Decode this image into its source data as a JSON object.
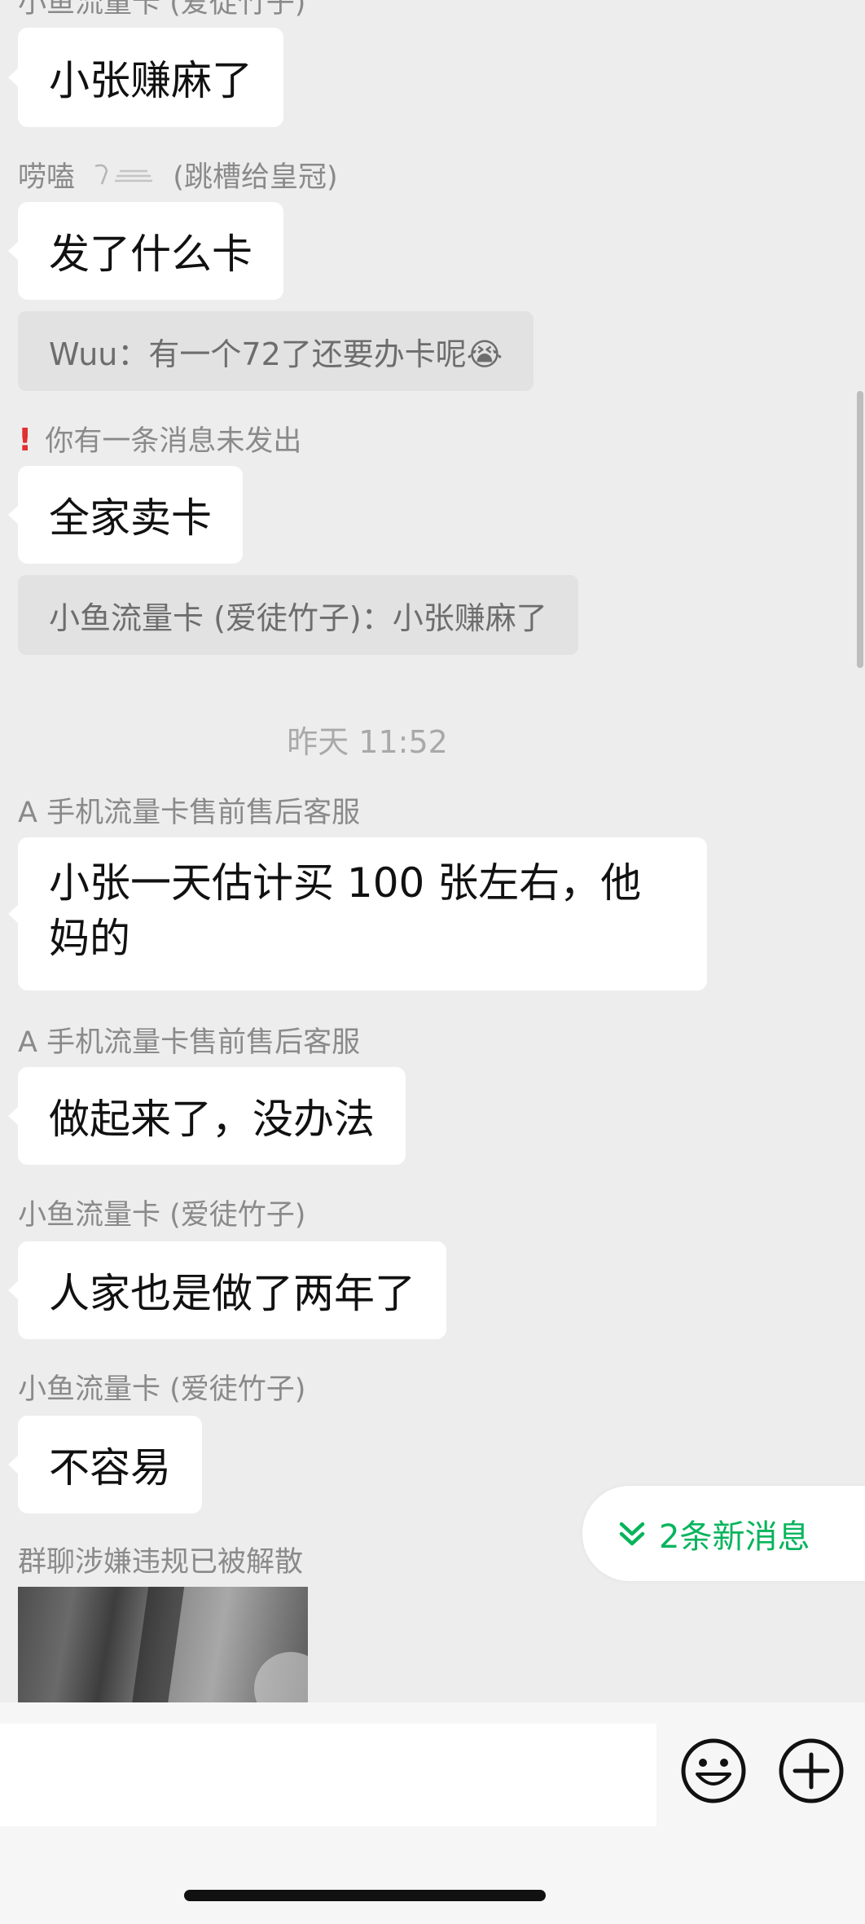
{
  "messages": {
    "m1": {
      "sender": "小鱼流量卡 (爱徒竹子)",
      "text": "小张赚麻了"
    },
    "m2": {
      "sender": "唠嗑",
      "sender_note": "(跳槽给皇冠)",
      "text": "发了什么卡",
      "quote": "Wuu：有一个72了还要办卡呢😭"
    },
    "m3": {
      "error": "你有一条消息未发出",
      "text": "全家卖卡",
      "quote": "小鱼流量卡 (爱徒竹子)：小张赚麻了"
    },
    "timestamp": "昨天 11:52",
    "m4": {
      "sender": "A  手机流量卡售前售后客服",
      "text": "小张一天估计买 100 张左右，他妈的"
    },
    "m5": {
      "sender": "A  手机流量卡售前售后客服",
      "text": "做起来了，没办法"
    },
    "m6": {
      "sender": "小鱼流量卡 (爱徒竹子)",
      "text": "人家也是做了两年了"
    },
    "m7": {
      "sender": "小鱼流量卡 (爱徒竹子)",
      "text": "不容易"
    },
    "m8": {
      "sender": "群聊涉嫌违规已被解散"
    }
  },
  "new_messages": {
    "label": "2条新消息"
  },
  "input_bar": {
    "emoji_icon": "emoji-icon",
    "plus_icon": "plus-icon"
  },
  "colors": {
    "background": "#ededed",
    "bubble": "#ffffff",
    "quote": "#e2e2e2",
    "accent": "#07b45c",
    "error": "#e03030"
  }
}
